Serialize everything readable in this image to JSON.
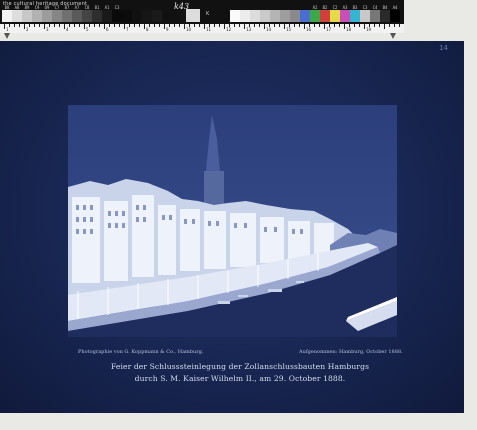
{
  "target": {
    "brand_text": "the cultural heritage document",
    "handwriting": "k43",
    "mid_label": "K",
    "top_labels_left": [
      "B8",
      "A8",
      "B9",
      "C9",
      "D9",
      "C7",
      "B7",
      "A7",
      "C8",
      "B1",
      "A1",
      "C3",
      "",
      "",
      "",
      "",
      "",
      "",
      "",
      "",
      ""
    ],
    "top_labels_right": [
      "",
      "",
      "",
      "",
      "",
      "",
      "",
      "",
      "A2",
      "B2",
      "C2",
      "A3",
      "B3",
      "C3",
      "C4",
      "B4",
      "A4"
    ],
    "ruler_numbers": [
      "1",
      "2",
      "3",
      "4",
      "5",
      "6",
      "7",
      "8",
      "9",
      "10",
      "11",
      "12",
      "13",
      "14",
      "15",
      "16",
      "17",
      "18",
      "19"
    ],
    "gray_left": [
      "#f2f2f2",
      "#dedede",
      "#c8c8c8",
      "#b2b2b2",
      "#9c9c9c",
      "#868686",
      "#707070",
      "#5a5a5a",
      "#444444",
      "#2e2e2e",
      "#1a1a1a",
      "#0a0a0a",
      "#0c0c0c",
      "#111111",
      "#151515",
      "#1a1a1a"
    ],
    "gray_right": [
      "#fafafa",
      "#ececec",
      "#dcdcdc",
      "#c9c9c9",
      "#b4b4b4",
      "#9e9e9e",
      "#8a8a8a",
      "#4a6ed0",
      "#3da84a",
      "#d0403e",
      "#e6d94a",
      "#c850b4",
      "#38b4d2",
      "#c8c8c8",
      "#777777",
      "#2a2a2a",
      "#000000"
    ]
  },
  "plate": {
    "corner_mark": "14"
  },
  "caption": {
    "photographer": "Photographie von G. Koppmann & Co., Hamburg.",
    "date_note": "Aufgenommen: Hamburg, October 1888.",
    "title_line1": "Feier der Schlusssteinlegung der Zollanschlussbauten Hamburgs",
    "title_line2": "durch S. M. Kaiser Wilhelm II., am 29. October 1888."
  },
  "colors": {
    "plate": "#16244a",
    "photo": "#2a3c74",
    "buildings": "#dfe6f4"
  }
}
